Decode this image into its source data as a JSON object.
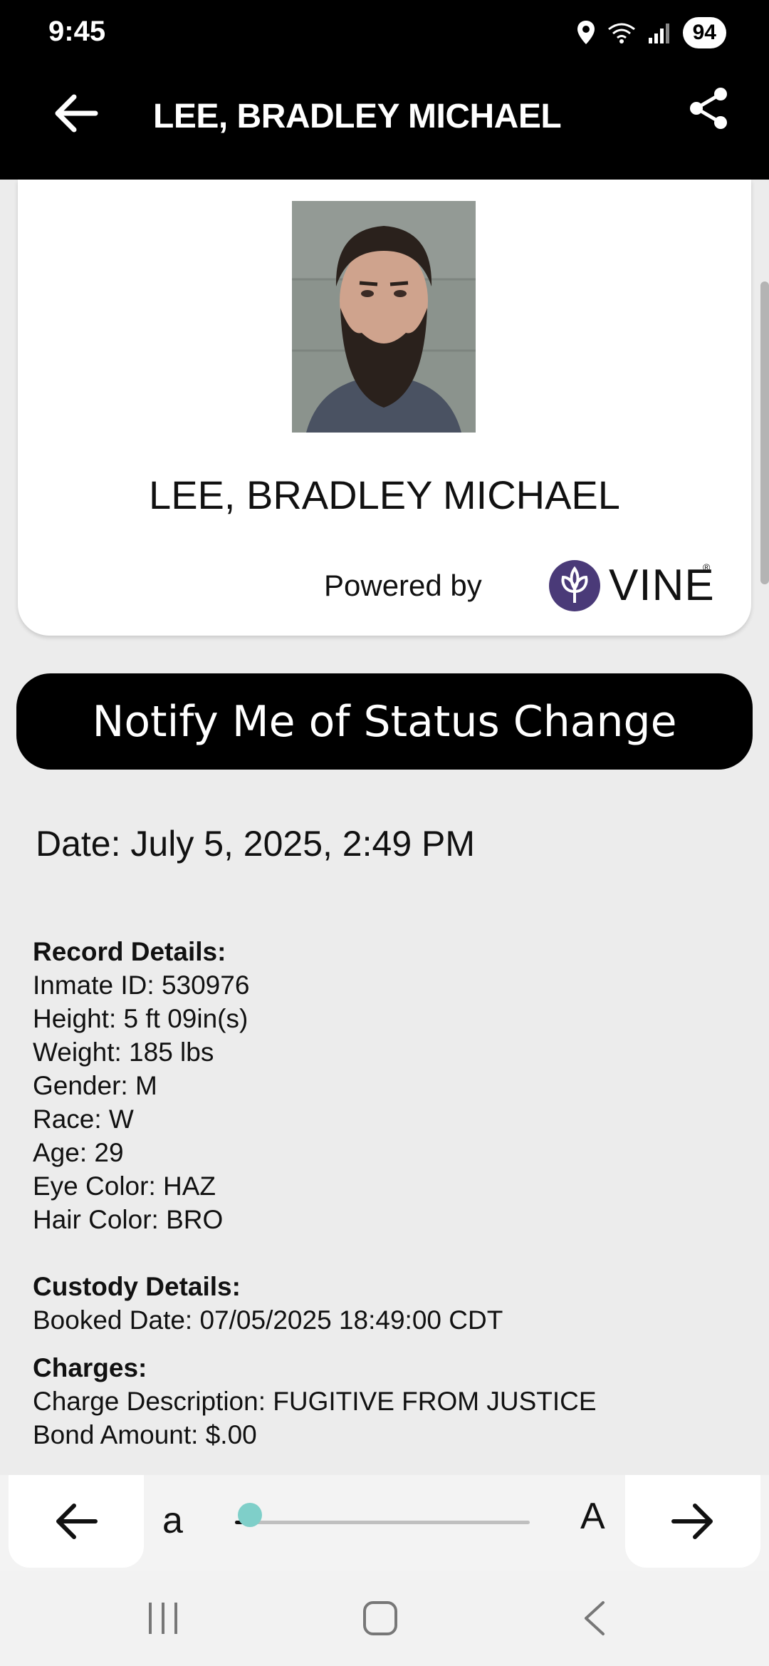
{
  "status_bar": {
    "time": "9:45",
    "battery": "94"
  },
  "app_bar": {
    "title": "LEE, BRADLEY MICHAEL"
  },
  "profile": {
    "name": "LEE, BRADLEY MICHAEL",
    "powered_by": "Powered by",
    "brand": "VINE",
    "brand_mark": "®"
  },
  "notify_button": "Notify Me of Status Change",
  "date_line": "Date: July 5, 2025, 2:49 PM",
  "record_details": {
    "heading": "Record Details:",
    "lines": [
      "Inmate ID: 530976",
      "Height: 5 ft 09in(s)",
      "Weight: 185 lbs",
      "Gender: M",
      "Race: W",
      "Age: 29",
      "Eye Color: HAZ",
      "Hair Color: BRO"
    ]
  },
  "custody_details": {
    "heading": "Custody Details:",
    "lines": [
      "Booked Date: 07/05/2025 18:49:00 CDT"
    ]
  },
  "charges": {
    "heading": "Charges:",
    "lines": [
      "Charge Description: FUGITIVE FROM JUSTICE",
      "Bond Amount: $.00"
    ]
  },
  "text_size_bar": {
    "small_label": "a",
    "large_label": "A",
    "level": 0.05
  },
  "colors": {
    "accent_slider": "#7fcfc9",
    "vine_purple": "#4a3a78",
    "bar_black": "#000000"
  }
}
